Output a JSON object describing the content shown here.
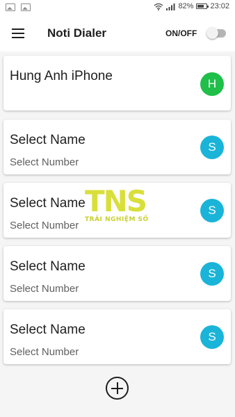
{
  "status_bar": {
    "battery_percent": "82%",
    "battery_level": 0.82,
    "time": "23:02",
    "icons": [
      "image-icon",
      "image-icon",
      "wifi-icon",
      "signal-icon",
      "battery-icon"
    ]
  },
  "app_bar": {
    "title": "Noti Dialer",
    "toggle_label": "ON/OFF",
    "toggle_on": false
  },
  "contacts": [
    {
      "name": "Hung Anh iPhone",
      "number": "",
      "initial": "H",
      "color": "#1fbf4a"
    },
    {
      "name": "Select Name",
      "number": "Select Number",
      "initial": "S",
      "color": "#1ab4d9"
    },
    {
      "name": "Select Name",
      "number": "Select Number",
      "initial": "S",
      "color": "#1ab4d9"
    },
    {
      "name": "Select Name",
      "number": "Select Number",
      "initial": "S",
      "color": "#1ab4d9"
    },
    {
      "name": "Select Name",
      "number": "Select Number",
      "initial": "S",
      "color": "#1ab4d9"
    }
  ],
  "add_button_icon": "plus-icon",
  "watermark": {
    "logo": "TNS",
    "subtitle": "TRẢI NGHIỆM SỐ"
  }
}
